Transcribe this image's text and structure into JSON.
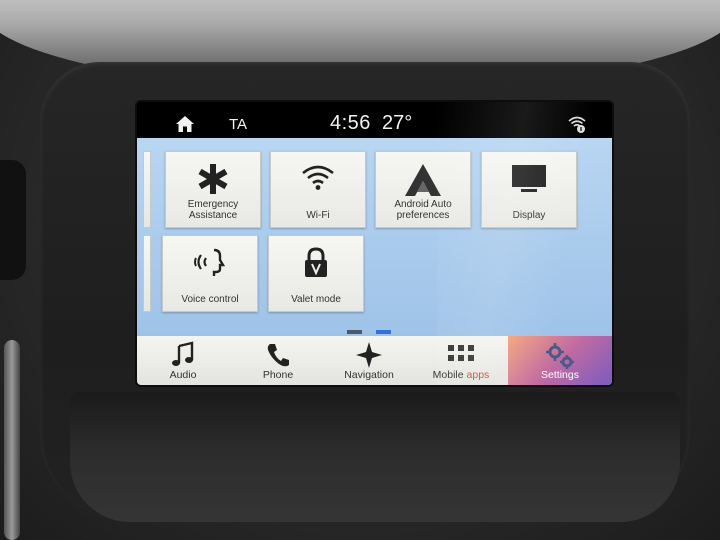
{
  "status_bar": {
    "label": "TA",
    "time": "4:56",
    "temperature": "27°"
  },
  "settings_tiles": [
    {
      "label": "Emergency Assistance",
      "icon": "emergency-star-of-life-icon"
    },
    {
      "label": "Wi-Fi",
      "icon": "wifi-icon"
    },
    {
      "label": "Android Auto preferences",
      "icon": "android-auto-icon"
    },
    {
      "label": "Display",
      "icon": "monitor-icon"
    },
    {
      "label": "Voice control",
      "icon": "voice-control-icon"
    },
    {
      "label": "Valet mode",
      "icon": "padlock-icon"
    }
  ],
  "pagination": {
    "pages": 2,
    "current": 2
  },
  "nav_bar": {
    "items": [
      {
        "label": "Audio",
        "icon": "music-note-icon"
      },
      {
        "label": "Phone",
        "icon": "phone-handset-icon"
      },
      {
        "label": "Navigation",
        "icon": "compass-star-icon"
      },
      {
        "label": "Mobile apps",
        "label_main": "Mobile ",
        "label_accent": "apps",
        "icon": "apps-grid-icon"
      },
      {
        "label": "Settings",
        "icon": "gears-icon",
        "active": true
      }
    ]
  },
  "colors": {
    "content_bg": "#a9cbec",
    "active_dot": "#2f73d6",
    "settings_active_gradient_start": "#f4a37c",
    "settings_active_gradient_end": "#7a5cc0",
    "status_bar_bg": "#000000"
  }
}
